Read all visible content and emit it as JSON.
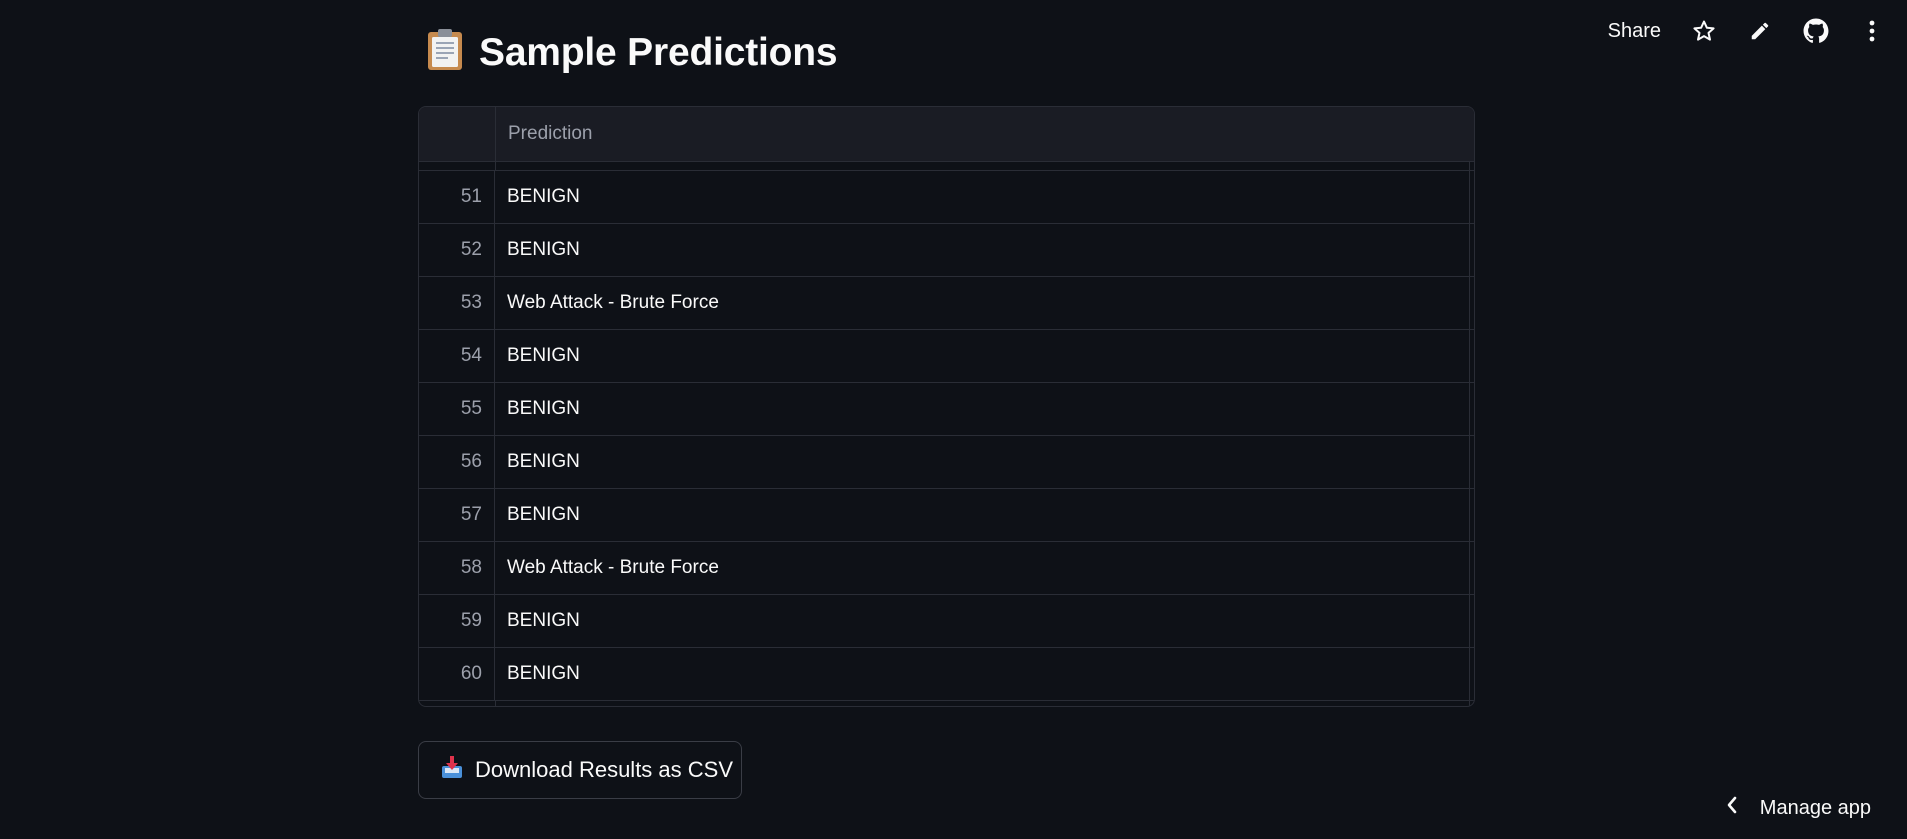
{
  "header": {
    "title": "Sample Predictions",
    "title_icon": "clipboard-icon"
  },
  "toolbar": {
    "share_label": "Share",
    "icons": [
      "star-icon",
      "pencil-icon",
      "github-icon",
      "more-vertical-icon"
    ]
  },
  "table": {
    "columns": [
      "",
      "Prediction"
    ],
    "rows": [
      {
        "index": "51",
        "prediction": "BENIGN"
      },
      {
        "index": "52",
        "prediction": "BENIGN"
      },
      {
        "index": "53",
        "prediction": "Web Attack - Brute Force"
      },
      {
        "index": "54",
        "prediction": "BENIGN"
      },
      {
        "index": "55",
        "prediction": "BENIGN"
      },
      {
        "index": "56",
        "prediction": "BENIGN"
      },
      {
        "index": "57",
        "prediction": "BENIGN"
      },
      {
        "index": "58",
        "prediction": "Web Attack - Brute Force"
      },
      {
        "index": "59",
        "prediction": "BENIGN"
      },
      {
        "index": "60",
        "prediction": "BENIGN"
      }
    ]
  },
  "download": {
    "label": "Download Results as CSV",
    "icon": "inbox-tray-icon"
  },
  "footer": {
    "manage_label": "Manage app",
    "icon": "chevron-left-icon"
  },
  "colors": {
    "background": "#0e1117",
    "header_bg": "#1a1c24",
    "border": "#2a2d36",
    "text": "#fafafa",
    "muted": "#9ca0ab"
  }
}
